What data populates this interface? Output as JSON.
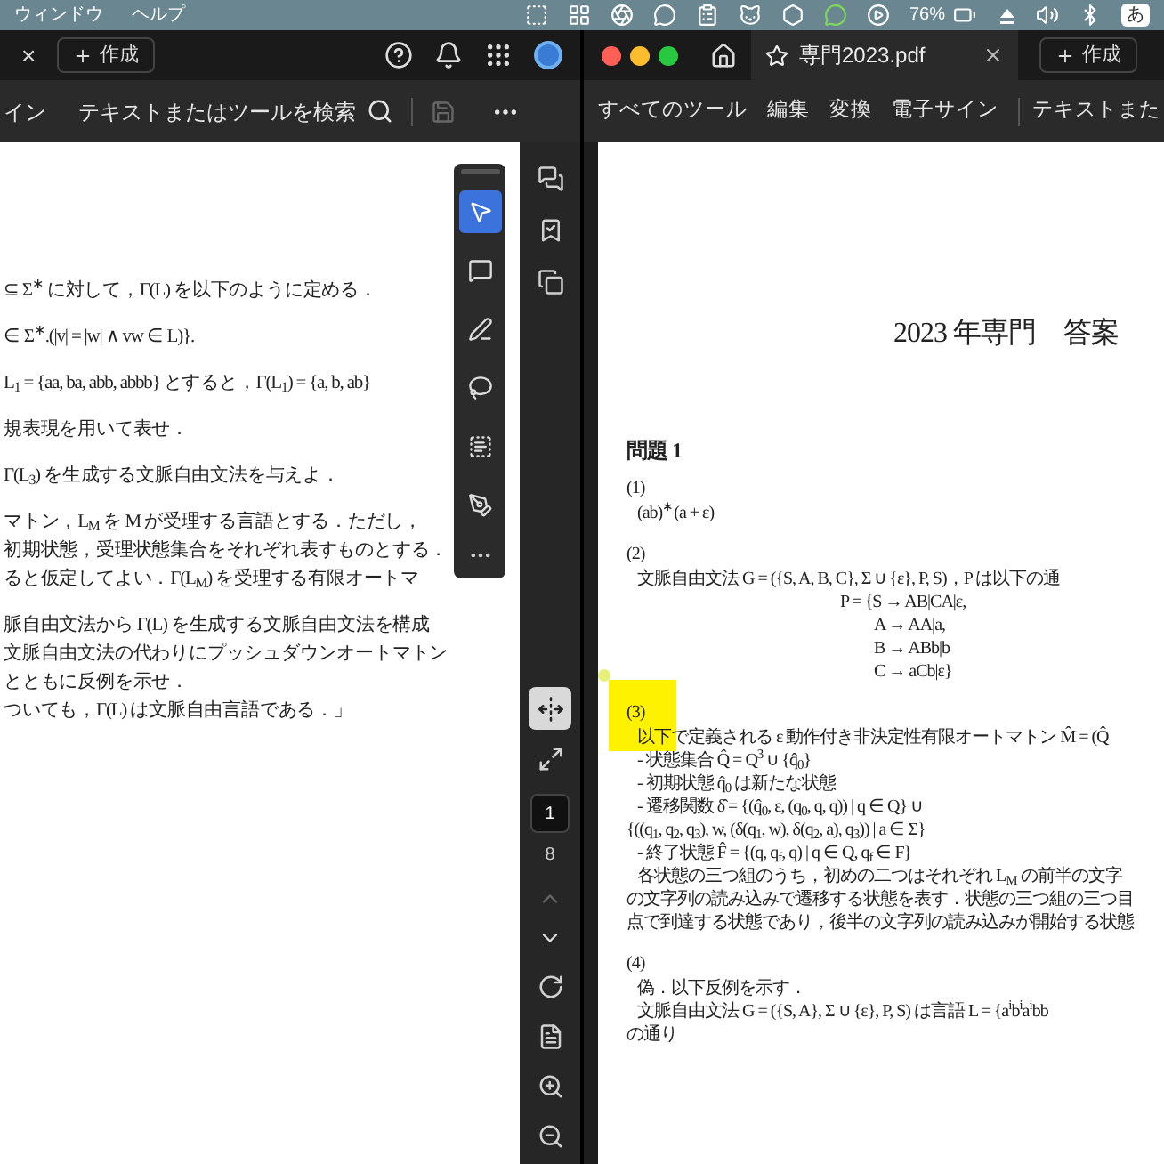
{
  "menubar": {
    "menus": [
      "ウィンドウ",
      "ヘルプ"
    ],
    "battery": "76%",
    "input_method": "あ"
  },
  "left_window": {
    "tab_close": "×",
    "new_button": "作成",
    "toolbar_label": "イン",
    "search": "テキストまたはツールを検索",
    "document_paragraphs": [
      [
        "⊆ Σ$^{∗}$ に対して，Γ(L) を以下のように定める．"
      ],
      [
        "∈ Σ$^{∗}$.(|v| = |w| ∧ vw ∈ L)}."
      ],
      [
        "L$_{1}$ = {aa, ba, abb, abbb} とすると，Γ(L$_{1}$) = {a, b, ab}"
      ],
      [
        "規表現を用いて表せ．"
      ],
      [
        "Γ(L$_{3}$) を生成する文脈自由文法を与えよ．"
      ],
      [
        "マトン，L$_{M}$ を M が受理する言語とする．ただし，",
        "初期状態，受理状態集合をそれぞれ表すものとする．",
        "ると仮定してよい．Γ(L$_{M}$) を受理する有限オートマ"
      ],
      [
        "脈自由文法から Γ(L) を生成する文脈自由文法を構成",
        "文脈自由文法の代わりにプッシュダウンオートマトン",
        "とともに反例を示せ．",
        "ついても，Γ(L) は文脈自由言語である．」"
      ]
    ],
    "palette": [
      {
        "kind": "pointer",
        "selected": true
      },
      {
        "kind": "comment",
        "selected": false
      },
      {
        "kind": "pen",
        "selected": false
      },
      {
        "kind": "lasso",
        "selected": false
      },
      {
        "kind": "textbox",
        "selected": false
      },
      {
        "kind": "sign",
        "selected": false
      }
    ],
    "sidebar_top": [
      {
        "kind": "comments",
        "selected": false
      },
      {
        "kind": "bookmarks",
        "selected": false
      },
      {
        "kind": "pages",
        "selected": false
      }
    ],
    "sidebar_view": [
      {
        "kind": "fit",
        "selected": true
      },
      {
        "kind": "expand",
        "selected": false
      }
    ],
    "page_number": "1",
    "page_count": "8",
    "sidebar_bottom": [
      {
        "kind": "rotate",
        "selected": false
      },
      {
        "kind": "document",
        "selected": false
      },
      {
        "kind": "zoom-in",
        "selected": false
      },
      {
        "kind": "zoom-out",
        "selected": false
      }
    ]
  },
  "right_window": {
    "tab": {
      "title": "専門2023.pdf"
    },
    "new_button": "作成",
    "tools": [
      {
        "label": "すべてのツール"
      },
      {
        "label": "編集"
      },
      {
        "label": "変換"
      },
      {
        "label": "電子サイン"
      }
    ],
    "search": "テキストまた",
    "document": {
      "title": "2023 年専門　答案",
      "heading": "問題 1",
      "sections": [
        {
          "label": "(1)",
          "highlighted": false,
          "lines": [
            {
              "kind": "text",
              "text": "(ab)$^{∗}$(a + ε)"
            }
          ]
        },
        {
          "label": "(2)",
          "highlighted": false,
          "lines": [
            {
              "kind": "text",
              "text": "文脈自由文法 G = ({S, A, B, C}, Σ ∪ {ε}, P, S)，P は以下の通"
            },
            {
              "kind": "display",
              "text": "P = {S → AB|CA|ε,"
            },
            {
              "kind": "display2",
              "text": "A → AA|a,"
            },
            {
              "kind": "display2",
              "text": "B → ABb|b"
            },
            {
              "kind": "display2",
              "text": "C → aCb|ε}"
            }
          ]
        },
        {
          "label": "(3)",
          "highlighted": true,
          "lines": [
            {
              "kind": "text",
              "text": "以下で定義される ε 動作付き非決定性有限オートマトン M̂ = (Q̂"
            },
            {
              "kind": "text",
              "text": "- 状態集合 Q̂ = Q$^{3}$ ∪ {q̂$_{0}$}"
            },
            {
              "kind": "text",
              "text": "- 初期状態 q̂$_{0}$ は新たな状態"
            },
            {
              "kind": "text",
              "text": "- 遷移関数 δ̂ = {(q̂$_{0}$, ε, (q$_{0}$, q, q)) | q ∈ Q} ∪"
            },
            {
              "kind": "flush",
              "text": "{((q$_{1}$, q$_{2}$, q$_{3}$), w, (δ(q$_{1}$, w), δ(q$_{2}$, a), q$_{3}$)) | a ∈ Σ}"
            },
            {
              "kind": "text",
              "text": "- 終了状態 F̂ = {(q, q$_{f}$, q) | q ∈ Q, q$_{f}$ ∈ F}"
            },
            {
              "kind": "text",
              "text": "各状態の三つ組のうち，初めの二つはそれぞれ L$_{M}$ の前半の文字"
            },
            {
              "kind": "flush",
              "text": "の文字列の読み込みで遷移する状態を表す．状態の三つ組の三つ目"
            },
            {
              "kind": "flush",
              "text": "点で到達する状態であり，後半の文字列の読み込みが開始する状態"
            }
          ]
        },
        {
          "label": "(4)",
          "highlighted": false,
          "lines": [
            {
              "kind": "text",
              "text": "偽．以下反例を示す．"
            },
            {
              "kind": "text",
              "text": "文脈自由文法 G = ({S, A}, Σ ∪ {ε}, P, S) は言語 L = {a$^{i}$b$^{i}$a$^{i}$bb"
            },
            {
              "kind": "flush",
              "text": "の通り"
            }
          ]
        }
      ]
    }
  }
}
